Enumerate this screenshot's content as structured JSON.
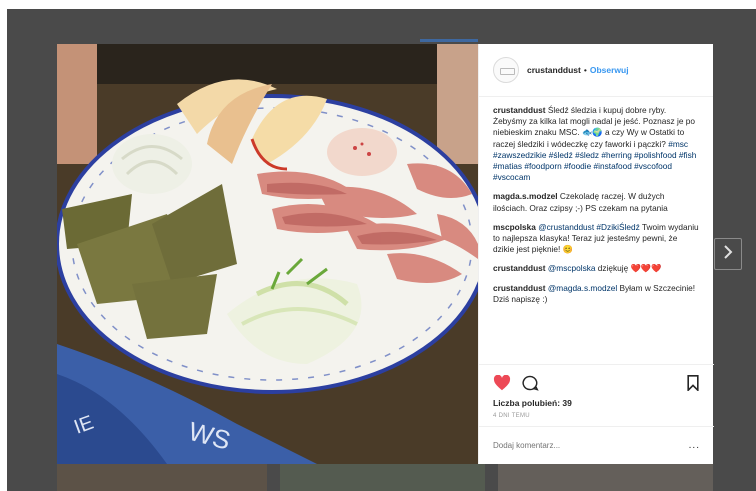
{
  "post": {
    "username": "crustanddust",
    "separator": "•",
    "follow_label": "Obserwuj",
    "likes": "Liczba polubień: 39",
    "time_ago": "4 DNI TEMU",
    "add_comment_placeholder": "Dodaj komentarz...",
    "more_label": "..."
  },
  "comments": [
    {
      "user": "crustanddust",
      "text": " Śledź śledzia i kupuj dobre ryby. Żebyśmy za kilka lat mogli nadal je jeść. Poznasz je po niebieskim znaku MSC. 🐟🌍 a czy Wy w Ostatki to raczej śledziki i wódeczkę czy faworki i pączki? ",
      "tags": "#msc #zawszedzikie #śledź #śledz #herring #polishfood #fish #matias #foodporn #foodie #instafood #vscofood #vscocam"
    },
    {
      "user": "magda.s.modzel",
      "text": " Czekoladę raczej. W dużych ilościach. Oraz czipsy ;-) PS czekam na pytania",
      "tags": ""
    },
    {
      "user": "mscpolska",
      "text": " Twoim wydaniu to najlepsza klasyka! Teraz już jesteśmy pewni, że dzikie jest pięknie! 😊",
      "tags": "",
      "mention": "@crustanddust #DzikiŚledź"
    },
    {
      "user": "crustanddust",
      "mention": "@mscpolska",
      "text": " dziękuję ❤️❤️❤️",
      "tags": ""
    },
    {
      "user": "crustanddust",
      "mention": "@magda.s.modzel",
      "text": " Byłam w Szczecinie! Dziś napiszę :)",
      "tags": ""
    }
  ],
  "colors": {
    "accent": "#3897f0",
    "heart": "#ed4956",
    "overlay": "#4a4a4a",
    "plate_rim": "#2c3fa0"
  },
  "icons": [
    "heart-icon",
    "comment-icon",
    "bookmark-icon",
    "chevron-right-icon"
  ]
}
